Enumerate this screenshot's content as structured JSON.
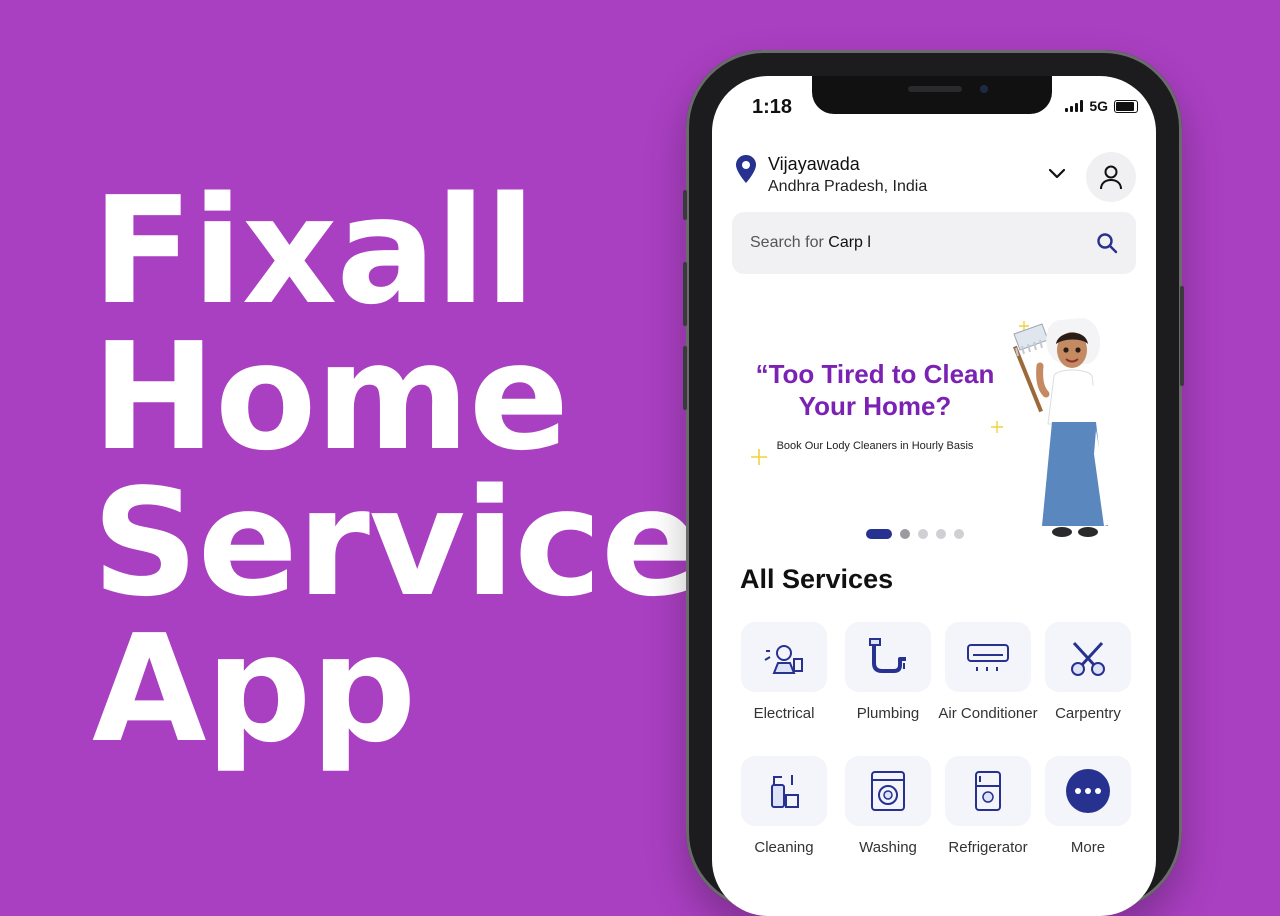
{
  "hero": {
    "line1": "Fixall",
    "line2": "Home",
    "line3": "Services",
    "line4": "App"
  },
  "status": {
    "time": "1:18",
    "network": "5G"
  },
  "location": {
    "city": "Vijayawada",
    "state": "Andhra Pradesh, India"
  },
  "search": {
    "prefix": "Search for",
    "query": "Carp l"
  },
  "banner": {
    "quote": "“Too Tired to Clean Your Home?",
    "subtitle": "Book Our Lody Cleaners in Hourly Basis"
  },
  "section_title": "All Services",
  "services": [
    {
      "label": "Electrical",
      "icon": "electrical-icon"
    },
    {
      "label": "Plumbing",
      "icon": "plumbing-icon"
    },
    {
      "label": "Air Conditioner",
      "icon": "air-conditioner-icon"
    },
    {
      "label": "Carpentry",
      "icon": "carpentry-icon"
    },
    {
      "label": "Cleaning",
      "icon": "cleaning-icon"
    },
    {
      "label": "Washing",
      "icon": "washing-machine-icon"
    },
    {
      "label": "Refrigerator",
      "icon": "refrigerator-icon"
    },
    {
      "label": "More",
      "icon": "more-icon"
    }
  ],
  "colors": {
    "background": "#a93fc1",
    "accent": "#27318f",
    "banner_text": "#7b22b4"
  }
}
